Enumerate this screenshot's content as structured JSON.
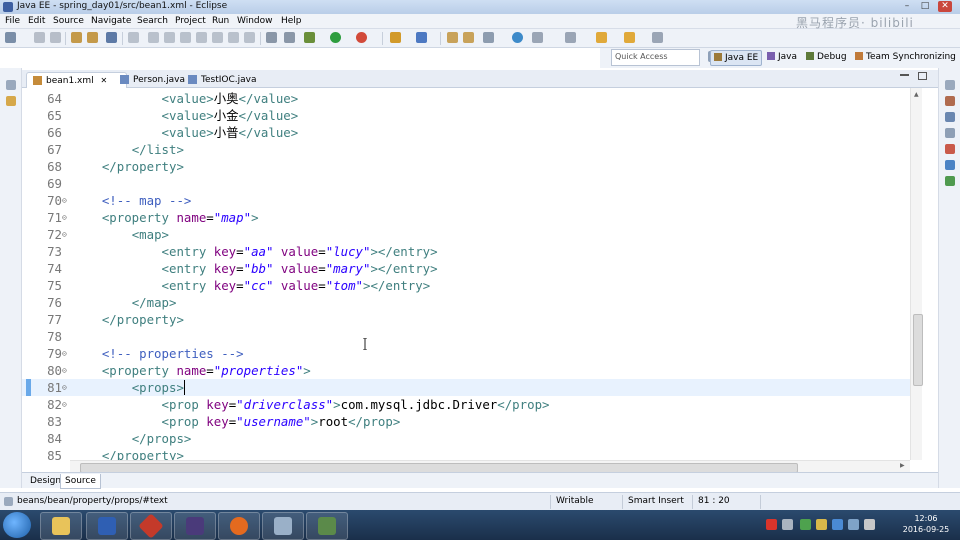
{
  "window": {
    "title": "Java EE - spring_day01/src/bean1.xml - Eclipse",
    "controls": [
      "–",
      "□",
      "✕"
    ]
  },
  "menu": [
    "File",
    "Edit",
    "Source",
    "Navigate",
    "Search",
    "Project",
    "Run",
    "Window",
    "Help"
  ],
  "quick_access": {
    "placeholder": "Quick Access"
  },
  "perspectives": [
    {
      "label": "Java EE",
      "icon": "javaee-icon"
    },
    {
      "label": "Java",
      "icon": "java-icon"
    },
    {
      "label": "Debug",
      "icon": "debug-icon"
    },
    {
      "label": "Team Synchronizing",
      "icon": "team-sync-icon"
    }
  ],
  "editor_tabs": [
    {
      "label": "bean1.xml",
      "close": "✕"
    },
    {
      "label": "Person.java"
    },
    {
      "label": "TestIOC.java"
    }
  ],
  "code_lines": [
    {
      "num": "64",
      "segs": [
        [
          "x",
          "            "
        ],
        [
          "t",
          "<value>"
        ],
        [
          "x",
          "小奥"
        ],
        [
          "t",
          "</value>"
        ]
      ]
    },
    {
      "num": "65",
      "segs": [
        [
          "x",
          "            "
        ],
        [
          "t",
          "<value>"
        ],
        [
          "x",
          "小金"
        ],
        [
          "t",
          "</value>"
        ]
      ]
    },
    {
      "num": "66",
      "segs": [
        [
          "x",
          "            "
        ],
        [
          "t",
          "<value>"
        ],
        [
          "x",
          "小普"
        ],
        [
          "t",
          "</value>"
        ]
      ]
    },
    {
      "num": "67",
      "segs": [
        [
          "x",
          "        "
        ],
        [
          "t",
          "</list>"
        ]
      ]
    },
    {
      "num": "68",
      "segs": [
        [
          "x",
          "    "
        ],
        [
          "t",
          "</property>"
        ]
      ]
    },
    {
      "num": "69",
      "segs": []
    },
    {
      "num": "70",
      "fold": true,
      "segs": [
        [
          "x",
          "    "
        ],
        [
          "c",
          "<!-- map -->"
        ]
      ]
    },
    {
      "num": "71",
      "fold": true,
      "segs": [
        [
          "x",
          "    "
        ],
        [
          "t",
          "<property "
        ],
        [
          "a",
          "name"
        ],
        [
          "x",
          "="
        ],
        [
          "v",
          "\"map\""
        ],
        [
          "t",
          ">"
        ]
      ]
    },
    {
      "num": "72",
      "fold": true,
      "segs": [
        [
          "x",
          "        "
        ],
        [
          "t",
          "<map>"
        ]
      ]
    },
    {
      "num": "73",
      "segs": [
        [
          "x",
          "            "
        ],
        [
          "t",
          "<entry "
        ],
        [
          "a",
          "key"
        ],
        [
          "x",
          "="
        ],
        [
          "v",
          "\"aa\""
        ],
        [
          "x",
          " "
        ],
        [
          "a",
          "value"
        ],
        [
          "x",
          "="
        ],
        [
          "v",
          "\"lucy\""
        ],
        [
          "t",
          "></entry>"
        ]
      ]
    },
    {
      "num": "74",
      "segs": [
        [
          "x",
          "            "
        ],
        [
          "t",
          "<entry "
        ],
        [
          "a",
          "key"
        ],
        [
          "x",
          "="
        ],
        [
          "v",
          "\"bb\""
        ],
        [
          "x",
          " "
        ],
        [
          "a",
          "value"
        ],
        [
          "x",
          "="
        ],
        [
          "v",
          "\"mary\""
        ],
        [
          "t",
          "></entry>"
        ]
      ]
    },
    {
      "num": "75",
      "segs": [
        [
          "x",
          "            "
        ],
        [
          "t",
          "<entry "
        ],
        [
          "a",
          "key"
        ],
        [
          "x",
          "="
        ],
        [
          "v",
          "\"cc\""
        ],
        [
          "x",
          " "
        ],
        [
          "a",
          "value"
        ],
        [
          "x",
          "="
        ],
        [
          "v",
          "\"tom\""
        ],
        [
          "t",
          "></entry>"
        ]
      ]
    },
    {
      "num": "76",
      "segs": [
        [
          "x",
          "        "
        ],
        [
          "t",
          "</map>"
        ]
      ]
    },
    {
      "num": "77",
      "segs": [
        [
          "x",
          "    "
        ],
        [
          "t",
          "</property>"
        ]
      ]
    },
    {
      "num": "78",
      "segs": []
    },
    {
      "num": "79",
      "fold": true,
      "segs": [
        [
          "x",
          "    "
        ],
        [
          "c",
          "<!-- properties -->"
        ]
      ]
    },
    {
      "num": "80",
      "fold": true,
      "segs": [
        [
          "x",
          "    "
        ],
        [
          "t",
          "<property "
        ],
        [
          "a",
          "name"
        ],
        [
          "x",
          "="
        ],
        [
          "v",
          "\"properties\""
        ],
        [
          "t",
          ">"
        ]
      ]
    },
    {
      "num": "81",
      "fold": true,
      "current": true,
      "segs": [
        [
          "x",
          "        "
        ],
        [
          "t",
          "<props>"
        ]
      ]
    },
    {
      "num": "82",
      "fold": true,
      "segs": [
        [
          "x",
          "            "
        ],
        [
          "t",
          "<prop "
        ],
        [
          "a",
          "key"
        ],
        [
          "x",
          "="
        ],
        [
          "v",
          "\"driverclass\""
        ],
        [
          "t",
          ">"
        ],
        [
          "x",
          "com.mysql.jdbc.Driver"
        ],
        [
          "t",
          "</prop>"
        ]
      ]
    },
    {
      "num": "83",
      "segs": [
        [
          "x",
          "            "
        ],
        [
          "t",
          "<prop "
        ],
        [
          "a",
          "key"
        ],
        [
          "x",
          "="
        ],
        [
          "v",
          "\"username\""
        ],
        [
          "t",
          ">"
        ],
        [
          "x",
          "root"
        ],
        [
          "t",
          "</prop>"
        ]
      ]
    },
    {
      "num": "84",
      "segs": [
        [
          "x",
          "        "
        ],
        [
          "t",
          "</props>"
        ]
      ]
    },
    {
      "num": "85",
      "segs": [
        [
          "x",
          "    "
        ],
        [
          "t",
          "</property>"
        ]
      ]
    }
  ],
  "bottom_tabs": [
    "Design",
    "Source"
  ],
  "status": {
    "path": "beans/bean/property/props/#text",
    "mode": "Writable",
    "insert": "Smart Insert",
    "position": "81 : 20"
  },
  "watermark": "黑马程序员",
  "clock": {
    "time": "12:06",
    "date": "2016-09-25"
  },
  "colors": {
    "tag": "#3f7f7f",
    "attr": "#7f007f",
    "value": "#2a00ff",
    "comment": "#3f5fbf",
    "current_line": "#e8f2fe"
  }
}
